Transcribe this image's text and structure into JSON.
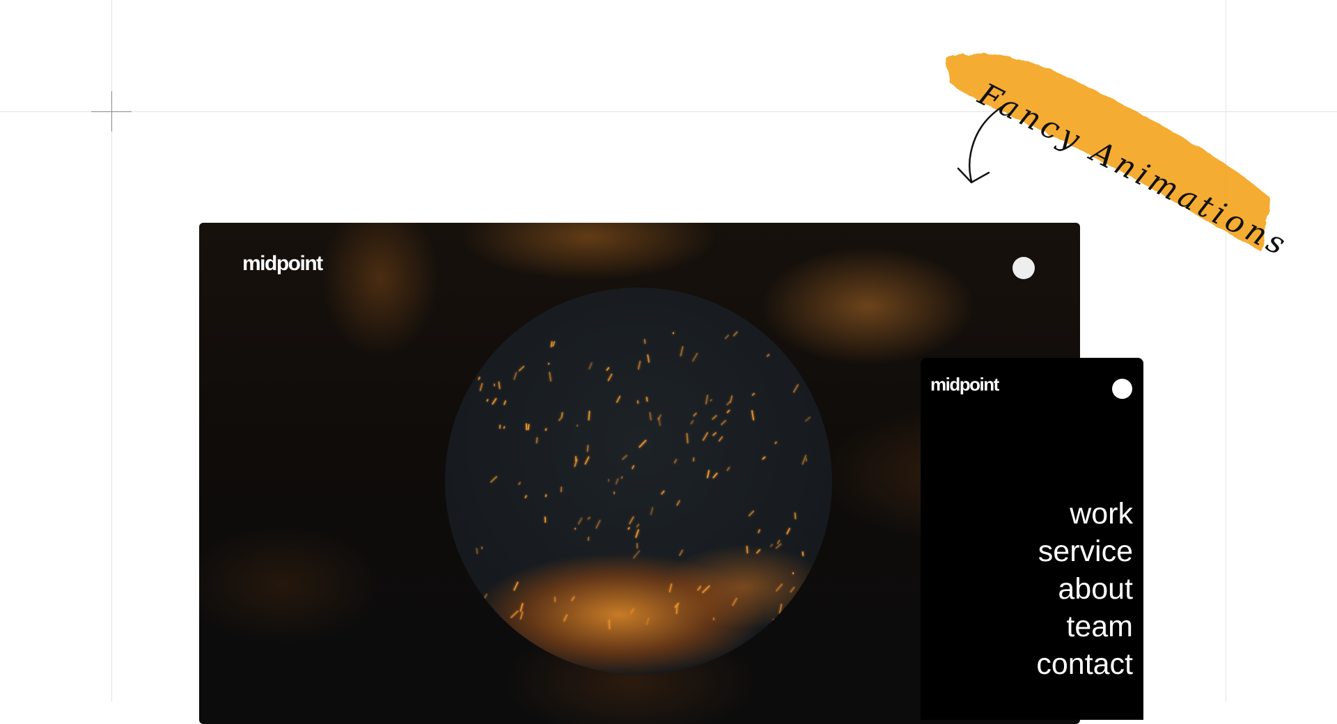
{
  "desktop": {
    "logo": "midpoint"
  },
  "mobile": {
    "logo": "midpoint",
    "nav": [
      "work",
      "service",
      "about",
      "team",
      "contact"
    ]
  },
  "annotation": {
    "text": "Fancy Animations",
    "highlight_color": "#f5a623"
  },
  "colors": {
    "background": "#ffffff",
    "guide_lines": "#e4e4e4",
    "mobile_bg": "#000000",
    "spark": "#e8902c",
    "nav_text": "#ffffff"
  },
  "icons": {
    "menu_toggle": "white-circle-icon",
    "annotation_arrow": "hand-drawn-arrow-icon"
  }
}
